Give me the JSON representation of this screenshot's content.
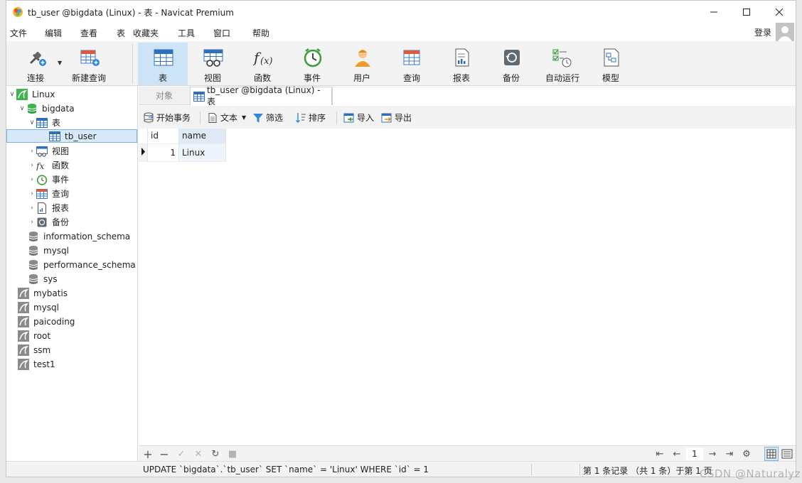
{
  "window": {
    "title": "tb_user @bigdata (Linux) - 表 - Navicat Premium"
  },
  "menu": [
    "文件",
    "编辑",
    "查看",
    "表",
    "收藏夹",
    "工具",
    "窗口",
    "帮助"
  ],
  "login_label": "登录",
  "toolbar": {
    "connect": "连接",
    "new_query": "新建查询",
    "table": "表",
    "view": "视图",
    "function": "函数",
    "event": "事件",
    "user": "用户",
    "query": "查询",
    "report": "报表",
    "backup": "备份",
    "automation": "自动运行",
    "model": "模型"
  },
  "navigator": {
    "connection": "Linux",
    "database": "bigdata",
    "tables_folder": "表",
    "table": "tb_user",
    "folders": [
      "视图",
      "函数",
      "事件",
      "查询",
      "报表",
      "备份"
    ],
    "other_dbs": [
      "information_schema",
      "mysql",
      "performance_schema",
      "sys"
    ],
    "other_connections": [
      "mybatis",
      "mysql",
      "paicoding",
      "root",
      "ssm",
      "test1"
    ]
  },
  "tabs": {
    "objects": "对象",
    "active": "tb_user @bigdata (Linux) - 表"
  },
  "subtoolbar": {
    "begin_transaction": "开始事务",
    "text": "文本",
    "filter": "筛选",
    "sort": "排序",
    "import": "导入",
    "export": "导出"
  },
  "grid": {
    "columns": [
      "id",
      "name"
    ],
    "rows": [
      [
        "1",
        "Linux"
      ]
    ]
  },
  "pagination": {
    "page": "1"
  },
  "status": {
    "sql": "UPDATE `bigdata`.`tb_user` SET `name` = 'Linux' WHERE `id` = 1",
    "records": "第 1 条记录 （共 1 条）于第 1 页"
  },
  "watermark": "CSDN @Naturalyz",
  "colors": {
    "selection": "#cde4f6",
    "accent": "#2e8ad8"
  }
}
